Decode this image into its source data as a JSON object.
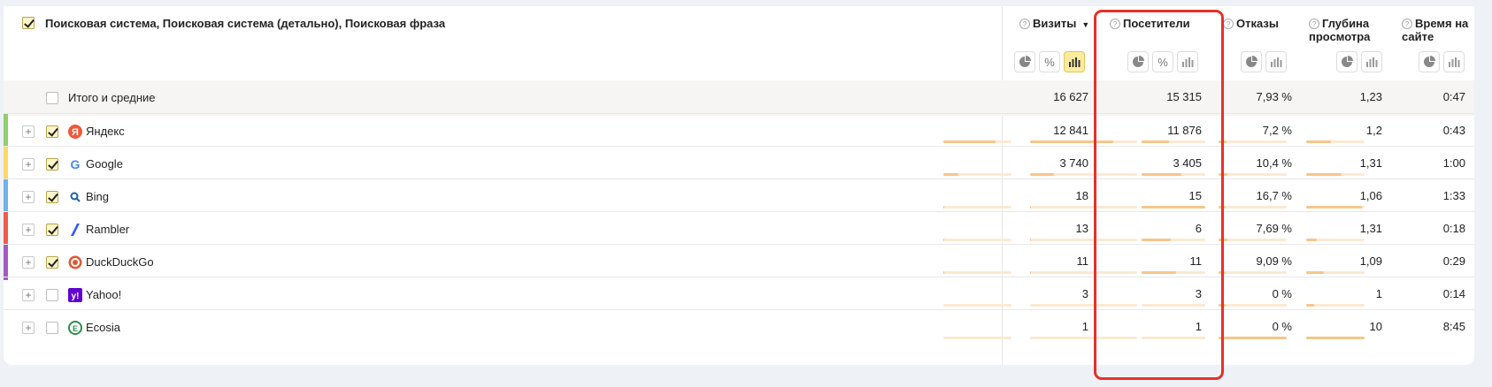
{
  "header": {
    "title": "Поисковая система, Поисковая система (детально), Поисковая фраза",
    "columns": [
      {
        "key": "visits",
        "label": "Визиты",
        "sort": "▼"
      },
      {
        "key": "visitors",
        "label": "Посетители"
      },
      {
        "key": "bounces",
        "label": "Отказы"
      },
      {
        "key": "depth",
        "label": "Глубина просмотра"
      },
      {
        "key": "time",
        "label": "Время на сайте"
      }
    ],
    "help_icon": "?"
  },
  "total": {
    "label": "Итого и средние",
    "visits": "16 627",
    "visitors": "15 315",
    "bounces": "7,93 %",
    "depth": "1,23",
    "time": "0:47"
  },
  "rows": [
    {
      "label": "Яндекс",
      "icon": "yandex-icon",
      "checked": true,
      "color": "#8fcf6f",
      "visits": "12 841",
      "visitors": "11 876",
      "bounces": "7,2 %",
      "depth": "1,2",
      "time": "0:43",
      "bars": [
        0.77,
        0.78,
        0.43,
        0.12,
        0.43
      ]
    },
    {
      "label": "Google",
      "icon": "google-icon",
      "checked": true,
      "color": "#ffd966",
      "visits": "3 740",
      "visitors": "3 405",
      "bounces": "10,4 %",
      "depth": "1,31",
      "time": "1:00",
      "bars": [
        0.22,
        0.22,
        0.62,
        0.13,
        0.6
      ]
    },
    {
      "label": "Bing",
      "icon": "bing-icon",
      "checked": true,
      "color": "#6fb3e8",
      "visits": "18",
      "visitors": "15",
      "bounces": "16,7 %",
      "depth": "1,06",
      "time": "1:33",
      "bars": [
        0.01,
        0.01,
        1.0,
        0.1,
        0.95
      ]
    },
    {
      "label": "Rambler",
      "icon": "rambler-icon",
      "checked": true,
      "color": "#ef5b4c",
      "visits": "13",
      "visitors": "6",
      "bounces": "7,69 %",
      "depth": "1,31",
      "time": "0:18",
      "bars": [
        0.01,
        0.01,
        0.46,
        0.13,
        0.18
      ]
    },
    {
      "label": "DuckDuckGo",
      "icon": "duckduckgo-icon",
      "checked": true,
      "color": "#a45bc2",
      "visits": "11",
      "visitors": "11",
      "bounces": "9,09 %",
      "depth": "1,09",
      "time": "0:29",
      "bars": [
        0.01,
        0.01,
        0.54,
        0.11,
        0.3
      ]
    },
    {
      "label": "Yahoo!",
      "icon": "yahoo-icon",
      "checked": false,
      "color": "",
      "visits": "3",
      "visitors": "3",
      "bounces": "0 %",
      "depth": "1",
      "time": "0:14",
      "bars": [
        0.0,
        0.0,
        0.0,
        0.1,
        0.14
      ]
    },
    {
      "label": "Ecosia",
      "icon": "ecosia-icon",
      "checked": false,
      "color": "",
      "visits": "1",
      "visitors": "1",
      "bounces": "0 %",
      "depth": "10",
      "time": "8:45",
      "bars": [
        0.0,
        0.0,
        0.0,
        1.0,
        1.0
      ]
    }
  ],
  "colors": {
    "highlight": "#e5312b",
    "bar": "#f6c68a",
    "bar_bg": "#fbe9d1",
    "active_btn": "#ffeba0"
  }
}
